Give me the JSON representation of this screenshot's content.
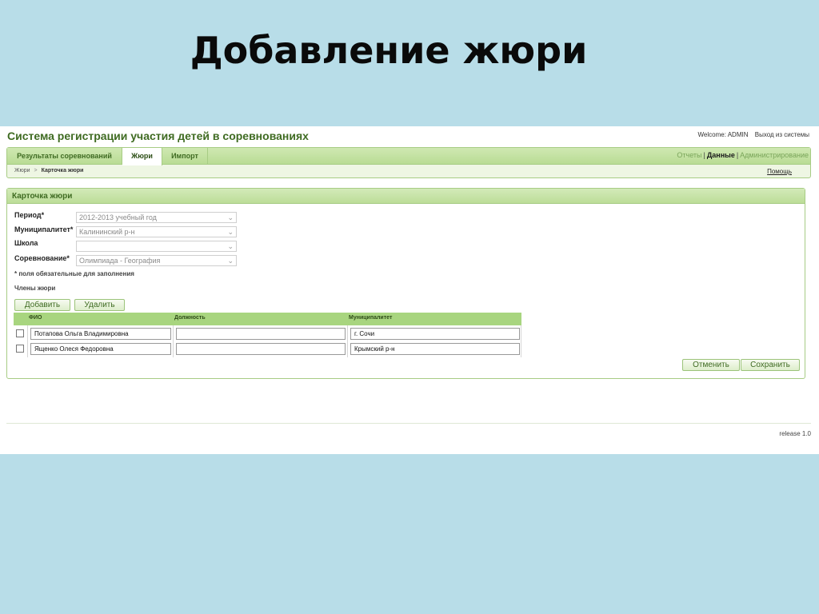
{
  "slide": {
    "title": "Добавление жюри"
  },
  "app": {
    "title": "Система регистрации участия детей в соревнованиях",
    "welcome": "Welcome: ADMIN",
    "logout": "Выход из системы"
  },
  "nav": {
    "tabs": [
      "Результаты соревнований",
      "Жюри",
      "Импорт"
    ],
    "active_tab": "Жюри",
    "links": [
      "Отчеты",
      "Данные",
      "Администрирование"
    ],
    "active_link": "Данные",
    "breadcrumb": [
      "Жюри",
      "Карточка жюри"
    ],
    "help": "Помощь"
  },
  "card": {
    "title": "Карточка жюри",
    "fields": [
      {
        "label": "Период*",
        "value": "2012-2013 учебный год"
      },
      {
        "label": "Муниципалитет*",
        "value": "Калининский р-н"
      },
      {
        "label": "Школа",
        "value": ""
      },
      {
        "label": "Соревнование*",
        "value": "Олимпиада - География"
      }
    ],
    "required_note": "* поля обязательные для заполнения",
    "members_label": "Члены жюри",
    "add_button": "Добавить",
    "delete_button": "Удалить",
    "table": {
      "columns": [
        "ФИО",
        "Должность",
        "Муниципалитет"
      ],
      "rows": [
        {
          "fio": "Потапова Ольга Владимировна",
          "position": "",
          "municipality": "г. Сочи",
          "checked": false
        },
        {
          "fio": "Ященко Олеся  Федоровна",
          "position": "",
          "municipality": "Крымский р-н",
          "checked": false
        }
      ]
    },
    "cancel_button": "Отменить",
    "save_button": "Сохранить"
  },
  "footer": {
    "release": "release 1.0"
  },
  "colors": {
    "background": "#b8dde8",
    "accent_green": "#3f6b22",
    "header_green": "#a8d57f"
  }
}
